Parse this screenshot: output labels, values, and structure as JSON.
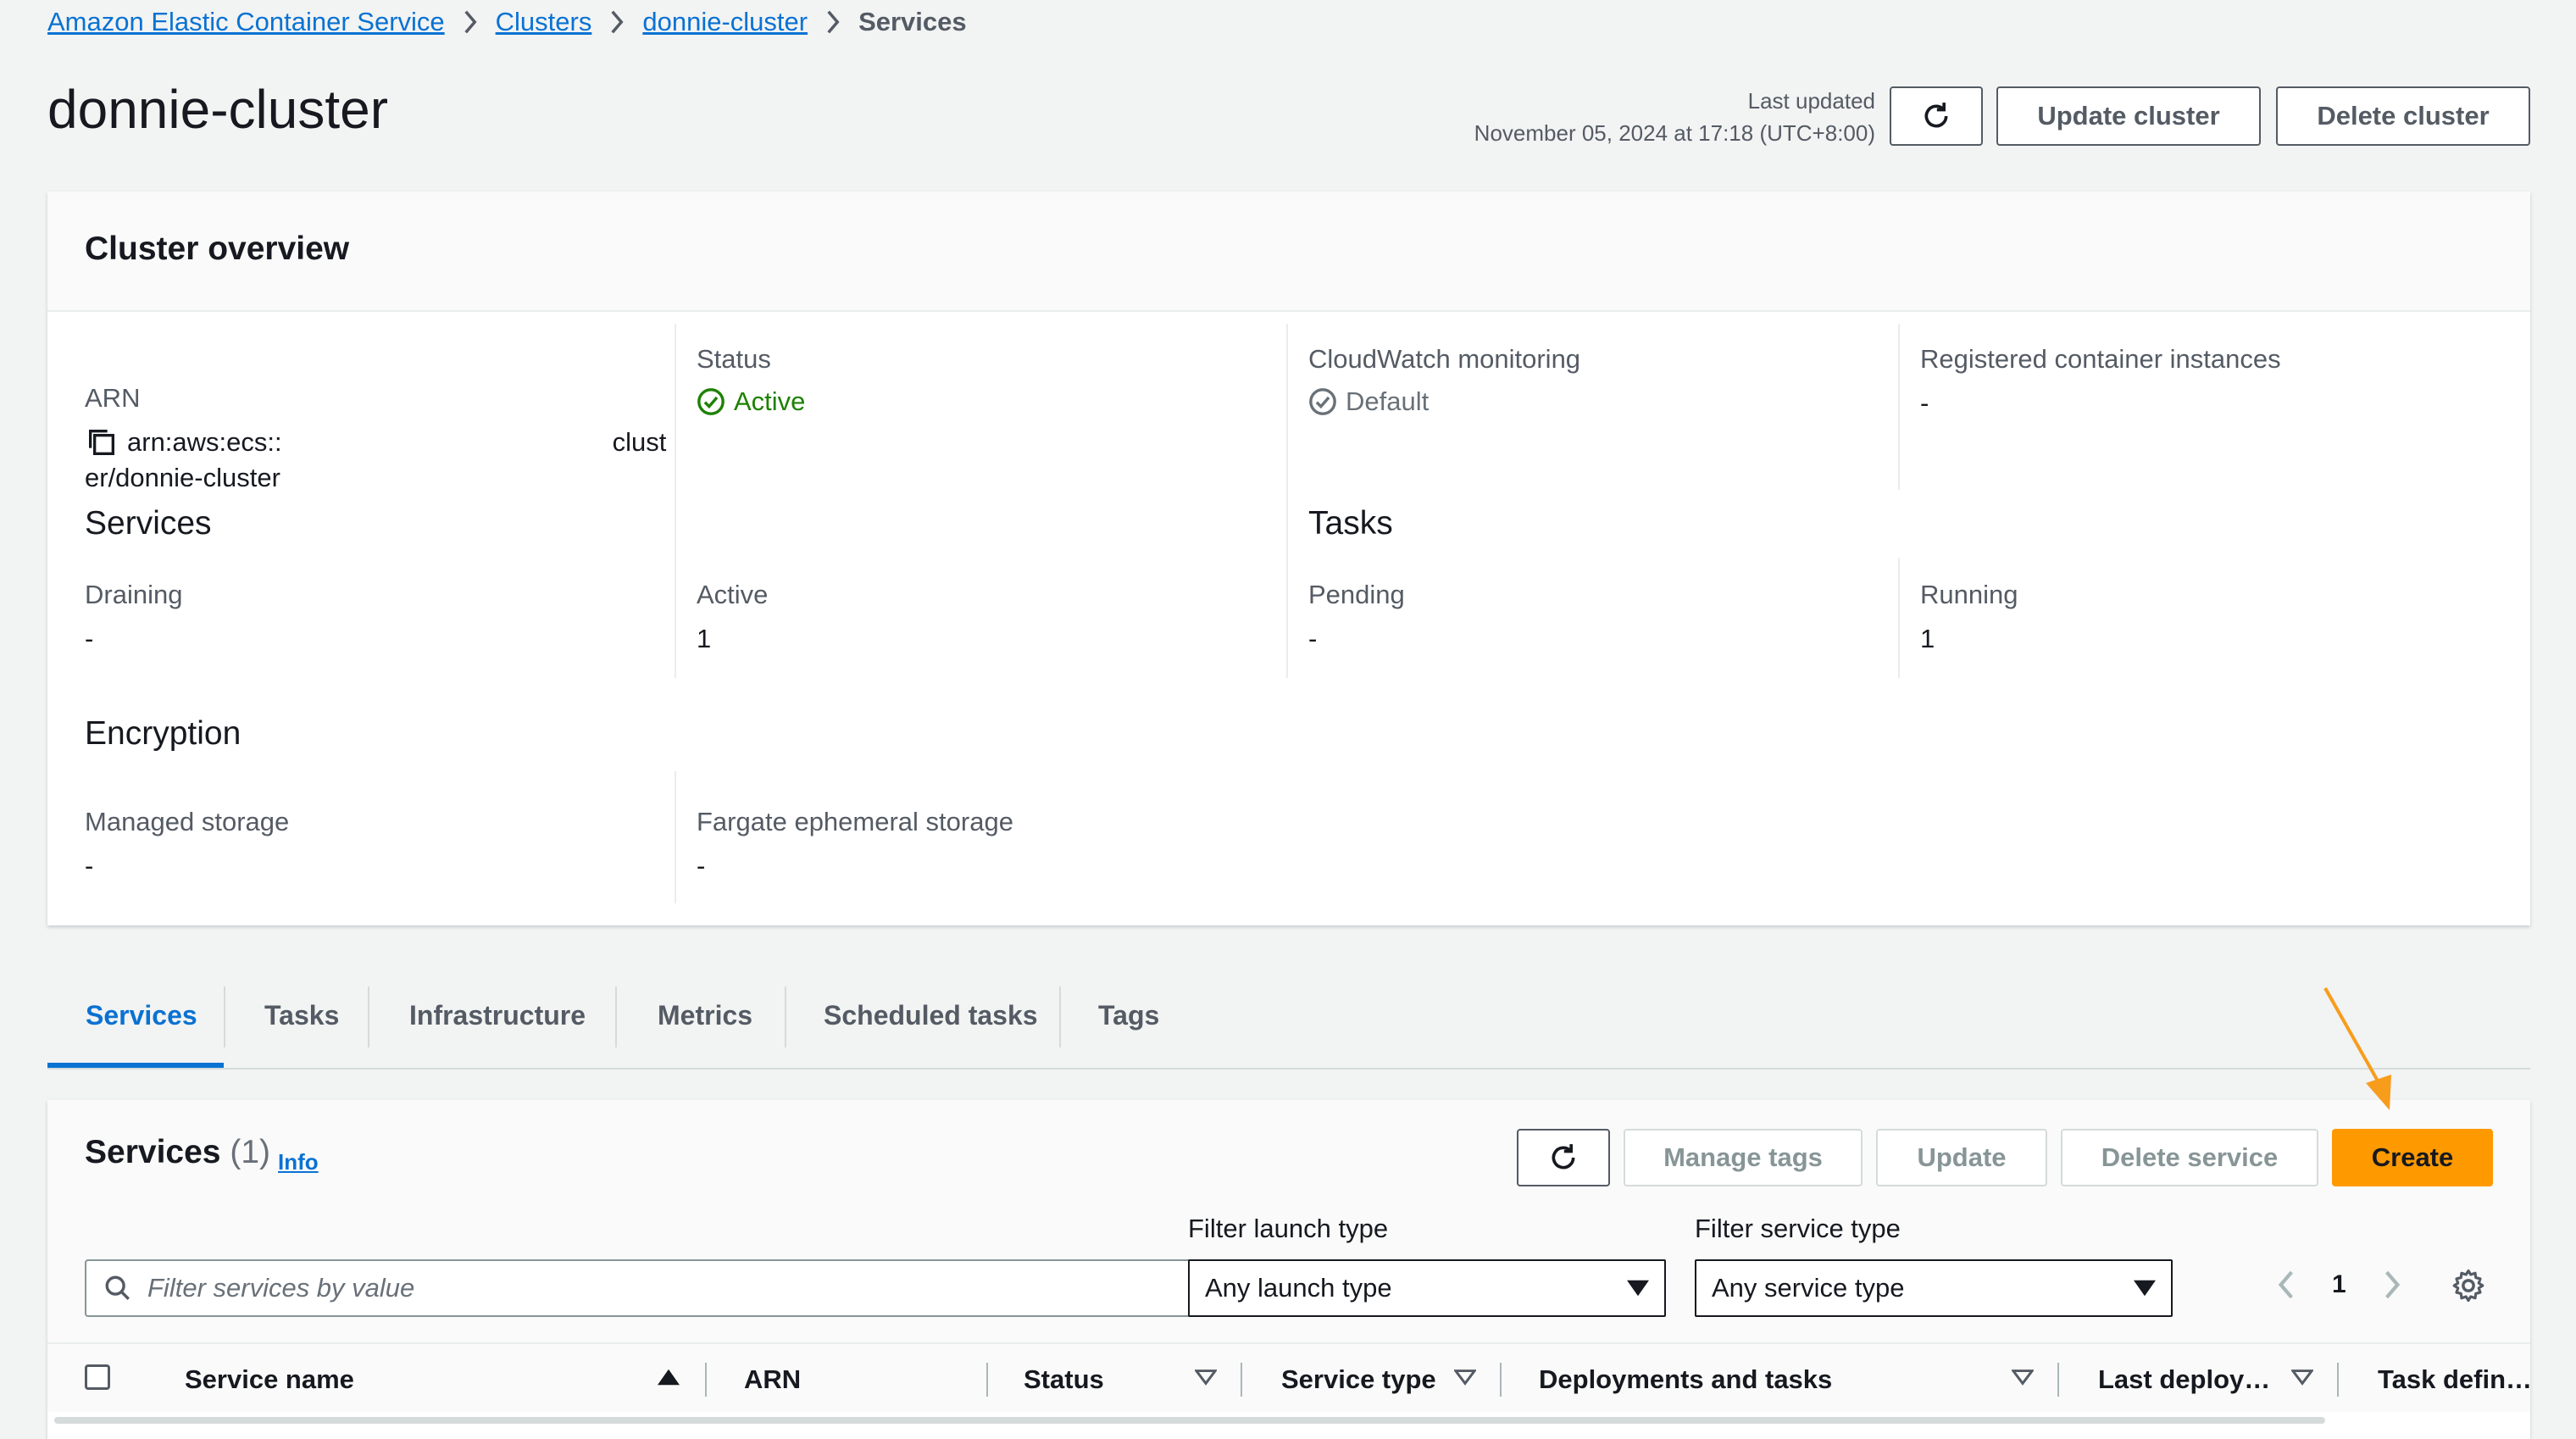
{
  "breadcrumb": {
    "items": [
      "Amazon Elastic Container Service",
      "Clusters",
      "donnie-cluster"
    ],
    "current": "Services"
  },
  "page": {
    "title": "donnie-cluster",
    "last_updated_label": "Last updated",
    "last_updated_value": "November 05, 2024 at 17:18 (UTC+8:00)",
    "update_cluster": "Update cluster",
    "delete_cluster": "Delete cluster"
  },
  "overview": {
    "title": "Cluster overview",
    "arn_label": "ARN",
    "arn_prefix": "arn:aws:ecs::",
    "arn_suffix_1": "clust",
    "arn_suffix_2": "er/donnie-cluster",
    "status_label": "Status",
    "status_value": "Active",
    "cloudwatch_label": "CloudWatch monitoring",
    "cloudwatch_value": "Default",
    "registered_label": "Registered container instances",
    "registered_value": "-",
    "services_heading": "Services",
    "draining_label": "Draining",
    "draining_value": "-",
    "active_label": "Active",
    "active_value": "1",
    "tasks_heading": "Tasks",
    "pending_label": "Pending",
    "pending_value": "-",
    "running_label": "Running",
    "running_value": "1",
    "encryption_heading": "Encryption",
    "managed_label": "Managed storage",
    "managed_value": "-",
    "fargate_label": "Fargate ephemeral storage",
    "fargate_value": "-"
  },
  "tabs": [
    "Services",
    "Tasks",
    "Infrastructure",
    "Metrics",
    "Scheduled tasks",
    "Tags"
  ],
  "services_panel": {
    "title": "Services",
    "count": "(1)",
    "info": "Info",
    "manage_tags": "Manage tags",
    "update": "Update",
    "delete_service": "Delete service",
    "create": "Create",
    "filter_launch_label": "Filter launch type",
    "filter_launch_value": "Any launch type",
    "filter_service_label": "Filter service type",
    "filter_service_value": "Any service type",
    "search_placeholder": "Filter services by value",
    "page_number": "1",
    "columns": [
      "Service name",
      "ARN",
      "Status",
      "Service type",
      "Deployments and tasks",
      "Last deploy…",
      "Task defin…"
    ]
  },
  "colors": {
    "link": "#0972d3",
    "primary": "#ff9900",
    "success": "#1d8102",
    "annotation_arrow": "#f89c1c"
  },
  "icons": [
    "chevron-right-icon",
    "refresh-icon",
    "copy-icon",
    "status-active-icon",
    "status-default-icon",
    "search-icon",
    "caret-down-icon",
    "chevron-left-icon",
    "gear-icon",
    "sort-icon"
  ]
}
